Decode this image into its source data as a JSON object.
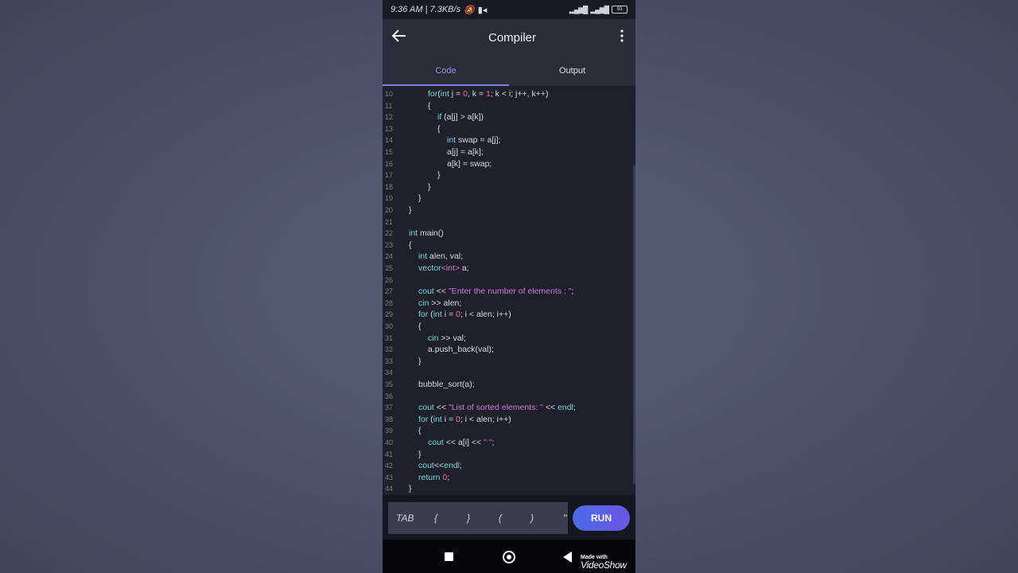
{
  "status_bar": {
    "time": "9:36 AM",
    "speed": "7.3KB/s",
    "battery": "93"
  },
  "app_bar": {
    "title": "Compiler"
  },
  "tabs": [
    {
      "label": "Code"
    },
    {
      "label": "Output"
    }
  ],
  "code_lines": [
    {
      "n": "10",
      "indent": 2,
      "tokens": [
        [
          "kw",
          "for"
        ],
        [
          "",
          "("
        ],
        [
          "kw",
          "int"
        ],
        [
          "",
          " j = "
        ],
        [
          "num",
          "0"
        ],
        [
          "",
          ", k = "
        ],
        [
          "num",
          "1"
        ],
        [
          "",
          "; k < i; j++, k++)"
        ]
      ]
    },
    {
      "n": "11",
      "indent": 2,
      "tokens": [
        [
          "",
          "{"
        ]
      ]
    },
    {
      "n": "12",
      "indent": 3,
      "tokens": [
        [
          "kw",
          "if"
        ],
        [
          "",
          " (a[j] > a[k])"
        ]
      ]
    },
    {
      "n": "13",
      "indent": 3,
      "tokens": [
        [
          "",
          "{"
        ]
      ]
    },
    {
      "n": "14",
      "indent": 4,
      "tokens": [
        [
          "kw",
          "int"
        ],
        [
          "",
          " swap = a[j];"
        ]
      ]
    },
    {
      "n": "15",
      "indent": 4,
      "tokens": [
        [
          "",
          "a[j] = a[k];"
        ]
      ]
    },
    {
      "n": "16",
      "indent": 4,
      "tokens": [
        [
          "",
          "a[k] = swap;"
        ]
      ]
    },
    {
      "n": "17",
      "indent": 3,
      "tokens": [
        [
          "",
          "}"
        ]
      ]
    },
    {
      "n": "18",
      "indent": 2,
      "tokens": [
        [
          "",
          "}"
        ]
      ]
    },
    {
      "n": "19",
      "indent": 1,
      "tokens": [
        [
          "",
          "}"
        ]
      ]
    },
    {
      "n": "20",
      "indent": 0,
      "tokens": [
        [
          "",
          "}"
        ]
      ]
    },
    {
      "n": "21",
      "indent": 0,
      "tokens": []
    },
    {
      "n": "22",
      "indent": 0,
      "tokens": [
        [
          "kw",
          "int"
        ],
        [
          "",
          " main()"
        ]
      ]
    },
    {
      "n": "23",
      "indent": 0,
      "tokens": [
        [
          "",
          "{"
        ]
      ]
    },
    {
      "n": "24",
      "indent": 1,
      "tokens": [
        [
          "kw",
          "int"
        ],
        [
          "",
          " alen, val;"
        ]
      ]
    },
    {
      "n": "25",
      "indent": 1,
      "tokens": [
        [
          "kw",
          "vector"
        ],
        [
          "ty",
          "<int>"
        ],
        [
          "",
          " a;"
        ]
      ]
    },
    {
      "n": "26",
      "indent": 0,
      "tokens": []
    },
    {
      "n": "27",
      "indent": 1,
      "tokens": [
        [
          "kw",
          "cout"
        ],
        [
          "",
          " << "
        ],
        [
          "str",
          "\"Enter the number of elements : \""
        ],
        [
          "",
          ";"
        ]
      ]
    },
    {
      "n": "28",
      "indent": 1,
      "tokens": [
        [
          "kw",
          "cin"
        ],
        [
          "",
          " >> alen;"
        ]
      ]
    },
    {
      "n": "29",
      "indent": 1,
      "tokens": [
        [
          "kw",
          "for"
        ],
        [
          "",
          " ("
        ],
        [
          "kw",
          "int"
        ],
        [
          "",
          " i = "
        ],
        [
          "num",
          "0"
        ],
        [
          "",
          "; i < alen; i++)"
        ]
      ]
    },
    {
      "n": "30",
      "indent": 1,
      "tokens": [
        [
          "",
          "{"
        ]
      ]
    },
    {
      "n": "31",
      "indent": 2,
      "tokens": [
        [
          "kw",
          "cin"
        ],
        [
          "",
          " >> val;"
        ]
      ]
    },
    {
      "n": "32",
      "indent": 2,
      "tokens": [
        [
          "",
          "a.push_back(val);"
        ]
      ]
    },
    {
      "n": "33",
      "indent": 1,
      "tokens": [
        [
          "",
          "}"
        ]
      ]
    },
    {
      "n": "34",
      "indent": 0,
      "tokens": []
    },
    {
      "n": "35",
      "indent": 1,
      "tokens": [
        [
          "",
          "bubble_sort(a);"
        ]
      ]
    },
    {
      "n": "36",
      "indent": 0,
      "tokens": []
    },
    {
      "n": "37",
      "indent": 1,
      "tokens": [
        [
          "kw",
          "cout"
        ],
        [
          "",
          " << "
        ],
        [
          "str",
          "\"List of sorted elements: \""
        ],
        [
          "",
          " << "
        ],
        [
          "kw",
          "endl"
        ],
        [
          "",
          ";"
        ]
      ]
    },
    {
      "n": "38",
      "indent": 1,
      "tokens": [
        [
          "kw",
          "for"
        ],
        [
          "",
          " ("
        ],
        [
          "kw",
          "int"
        ],
        [
          "",
          " i = "
        ],
        [
          "num",
          "0"
        ],
        [
          "",
          "; i < alen; i++)"
        ]
      ]
    },
    {
      "n": "39",
      "indent": 1,
      "tokens": [
        [
          "",
          "{"
        ]
      ]
    },
    {
      "n": "40",
      "indent": 2,
      "tokens": [
        [
          "kw",
          "cout"
        ],
        [
          "",
          " << a[i] << "
        ],
        [
          "str",
          "\" \""
        ],
        [
          "",
          ";"
        ]
      ]
    },
    {
      "n": "41",
      "indent": 1,
      "tokens": [
        [
          "",
          "}"
        ]
      ]
    },
    {
      "n": "42",
      "indent": 1,
      "tokens": [
        [
          "kw",
          "cout"
        ],
        [
          "",
          "<<"
        ],
        [
          "kw",
          "endl"
        ],
        [
          "",
          ";"
        ]
      ]
    },
    {
      "n": "43",
      "indent": 1,
      "tokens": [
        [
          "kw",
          "return"
        ],
        [
          "",
          " "
        ],
        [
          "num",
          "0"
        ],
        [
          "",
          ";"
        ]
      ]
    },
    {
      "n": "44",
      "indent": 0,
      "tokens": [
        [
          "",
          "}"
        ]
      ]
    }
  ],
  "keys": {
    "tab": "TAB",
    "lbrace": "{",
    "rbrace": "}",
    "lparen": "(",
    "rparen": ")",
    "quote": "\""
  },
  "run_button": "RUN",
  "watermark": {
    "line1": "Made with",
    "line2": "VideoShow"
  },
  "colors": {
    "keyword": "#6fd7e2",
    "number": "#ec6d86",
    "string": "#c77adf",
    "accent": "#7d7fe6"
  }
}
